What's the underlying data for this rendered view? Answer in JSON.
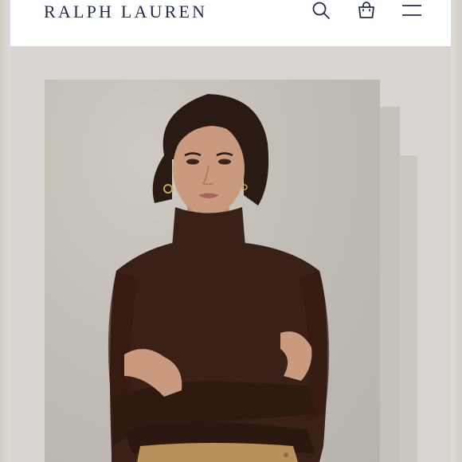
{
  "header": {
    "brand": "RALPH LAUREN",
    "icons": [
      "search-icon",
      "shopping-bag-icon",
      "menu-icon"
    ]
  },
  "product_image": {
    "description_icon": "model-photo"
  },
  "colors": {
    "brand_navy": "#1f2c4a",
    "sweater_brown": "#3a2118",
    "backdrop": "#d8d4cf"
  }
}
